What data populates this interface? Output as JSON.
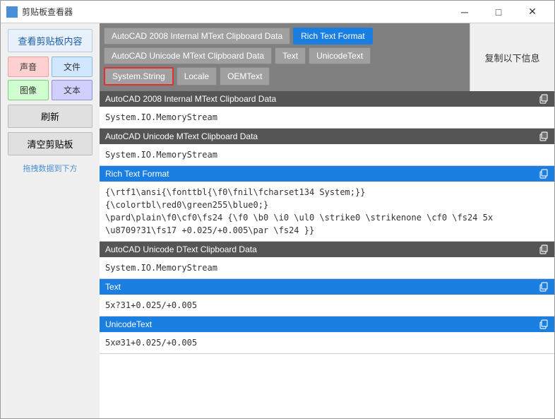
{
  "titlebar": {
    "icon": "clipboard",
    "title": "剪贴板查看器",
    "minimize": "─",
    "maximize": "□",
    "close": "✕"
  },
  "sidebar": {
    "view_btn": "查看剪贴板内容",
    "sound_label": "声音",
    "file_label": "文件",
    "image_label": "图像",
    "text_label": "文本",
    "refresh_label": "刷新",
    "clear_label": "清空剪贴板",
    "drag_hint": "拖拽数据到下方"
  },
  "copy_info": "复制以下信息",
  "format_buttons": {
    "row1": [
      {
        "label": "AutoCAD 2008 Internal MText Clipboard Data",
        "active": false,
        "red_border": false
      },
      {
        "label": "Rich Text Format",
        "active": true,
        "red_border": false
      }
    ],
    "row2": [
      {
        "label": "AutoCAD Unicode MText Clipboard Data",
        "active": false,
        "red_border": false
      },
      {
        "label": "Text",
        "active": false,
        "red_border": false
      },
      {
        "label": "UnicodeText",
        "active": false,
        "red_border": false
      }
    ],
    "row3": [
      {
        "label": "System.String",
        "active": false,
        "red_border": true
      },
      {
        "label": "Locale",
        "active": false,
        "red_border": false
      },
      {
        "label": "OEMText",
        "active": false,
        "red_border": false
      }
    ]
  },
  "sections": [
    {
      "title": "AutoCAD 2008 Internal MText Clipboard Data",
      "blue": false,
      "body": "System.IO.MemoryStream"
    },
    {
      "title": "AutoCAD Unicode MText Clipboard Data",
      "blue": false,
      "body": "System.IO.MemoryStream"
    },
    {
      "title": "Rich Text Format",
      "blue": true,
      "body": "{\\rtf1\\ansi{\\fonttbl{\\f0\\fnil\\fcharset134 System;}}\n{\\colortbl\\red0\\green255\\blue0;}\n\\pard\\plain\\f0\\cf0\\fs24 {\\f0 \\b0 \\i0 \\ul0 \\strike0 \\strikenone \\cf0 \\fs24 5x\n\\u8709?31\\fs17 +0.025/+0.005\\par \\fs24 }}"
    },
    {
      "title": "AutoCAD Unicode DText Clipboard Data",
      "blue": false,
      "body": "System.IO.MemoryStream"
    },
    {
      "title": "Text",
      "blue": true,
      "body": "5x?31+0.025/+0.005"
    },
    {
      "title": "UnicodeText",
      "blue": true,
      "body": "5x∅31+0.025/+0.005"
    }
  ]
}
